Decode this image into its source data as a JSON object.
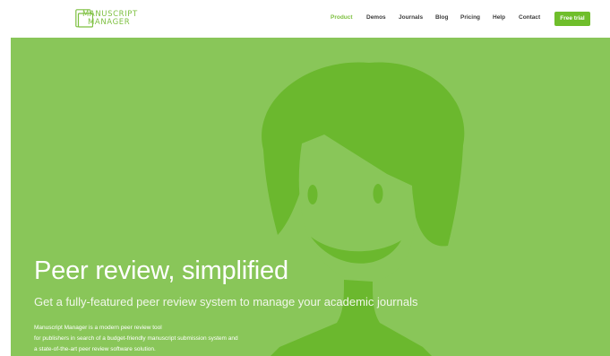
{
  "brand": {
    "line1": "MANUSCRIPT",
    "line2": "MANAGER",
    "colors": {
      "accent": "#7ec041",
      "hero_bg": "#89c659",
      "figure": "#6bb82e",
      "button": "#6fbe2b"
    }
  },
  "nav": {
    "items": [
      {
        "label": "Product",
        "active": true
      },
      {
        "label": "Demos"
      },
      {
        "label": "Journals"
      },
      {
        "label": "Blog"
      },
      {
        "label": "Pricing"
      },
      {
        "label": "Help"
      },
      {
        "label": "Contact"
      }
    ],
    "cta": "Free trial"
  },
  "hero": {
    "title": "Peer review, simplified",
    "subtitle": "Get a fully-featured peer review system to manage your academic journals",
    "body": [
      "Manuscript Manager is a modern peer review tool",
      "for publishers in search of a budget-friendly manuscript submission system and",
      "a state-of-the-art peer review software solution."
    ],
    "illustration": "woman-illustration"
  }
}
